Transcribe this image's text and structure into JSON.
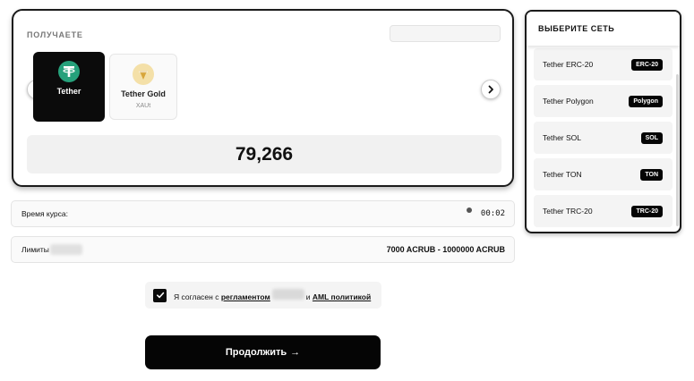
{
  "receive": {
    "label": "ПОЛУЧАЕТЕ",
    "search_placeholder": "",
    "coins": [
      {
        "name": "Tether",
        "ticker": "",
        "selected": true,
        "icon": "tether-icon",
        "color": "#26a17b"
      },
      {
        "name": "Tether Gold",
        "ticker": "XAUt",
        "selected": false,
        "icon": "tether-gold-icon",
        "color": "#d7a53a"
      }
    ],
    "amount": "79,266"
  },
  "rate": {
    "label": "Время курса:",
    "timer": "00:02"
  },
  "limits": {
    "label": "Лимиты",
    "value": "7000 ACRUB - 1000000 ACRUB"
  },
  "agreement": {
    "checked": true,
    "prefix": "Я согласен с",
    "link_rules": "регламентом",
    "conjunction": "и",
    "link_aml": "AML политикой"
  },
  "continue_button": {
    "label": "Продолжить",
    "arrow": "→"
  },
  "network": {
    "title": "ВЫБЕРИТЕ СЕТЬ",
    "items": [
      {
        "name": "Tether ERC-20",
        "badge": "ERC-20"
      },
      {
        "name": "Tether Polygon",
        "badge": "Polygon"
      },
      {
        "name": "Tether SOL",
        "badge": "SOL"
      },
      {
        "name": "Tether TON",
        "badge": "TON"
      },
      {
        "name": "Tether TRC-20",
        "badge": "TRC-20"
      }
    ]
  }
}
